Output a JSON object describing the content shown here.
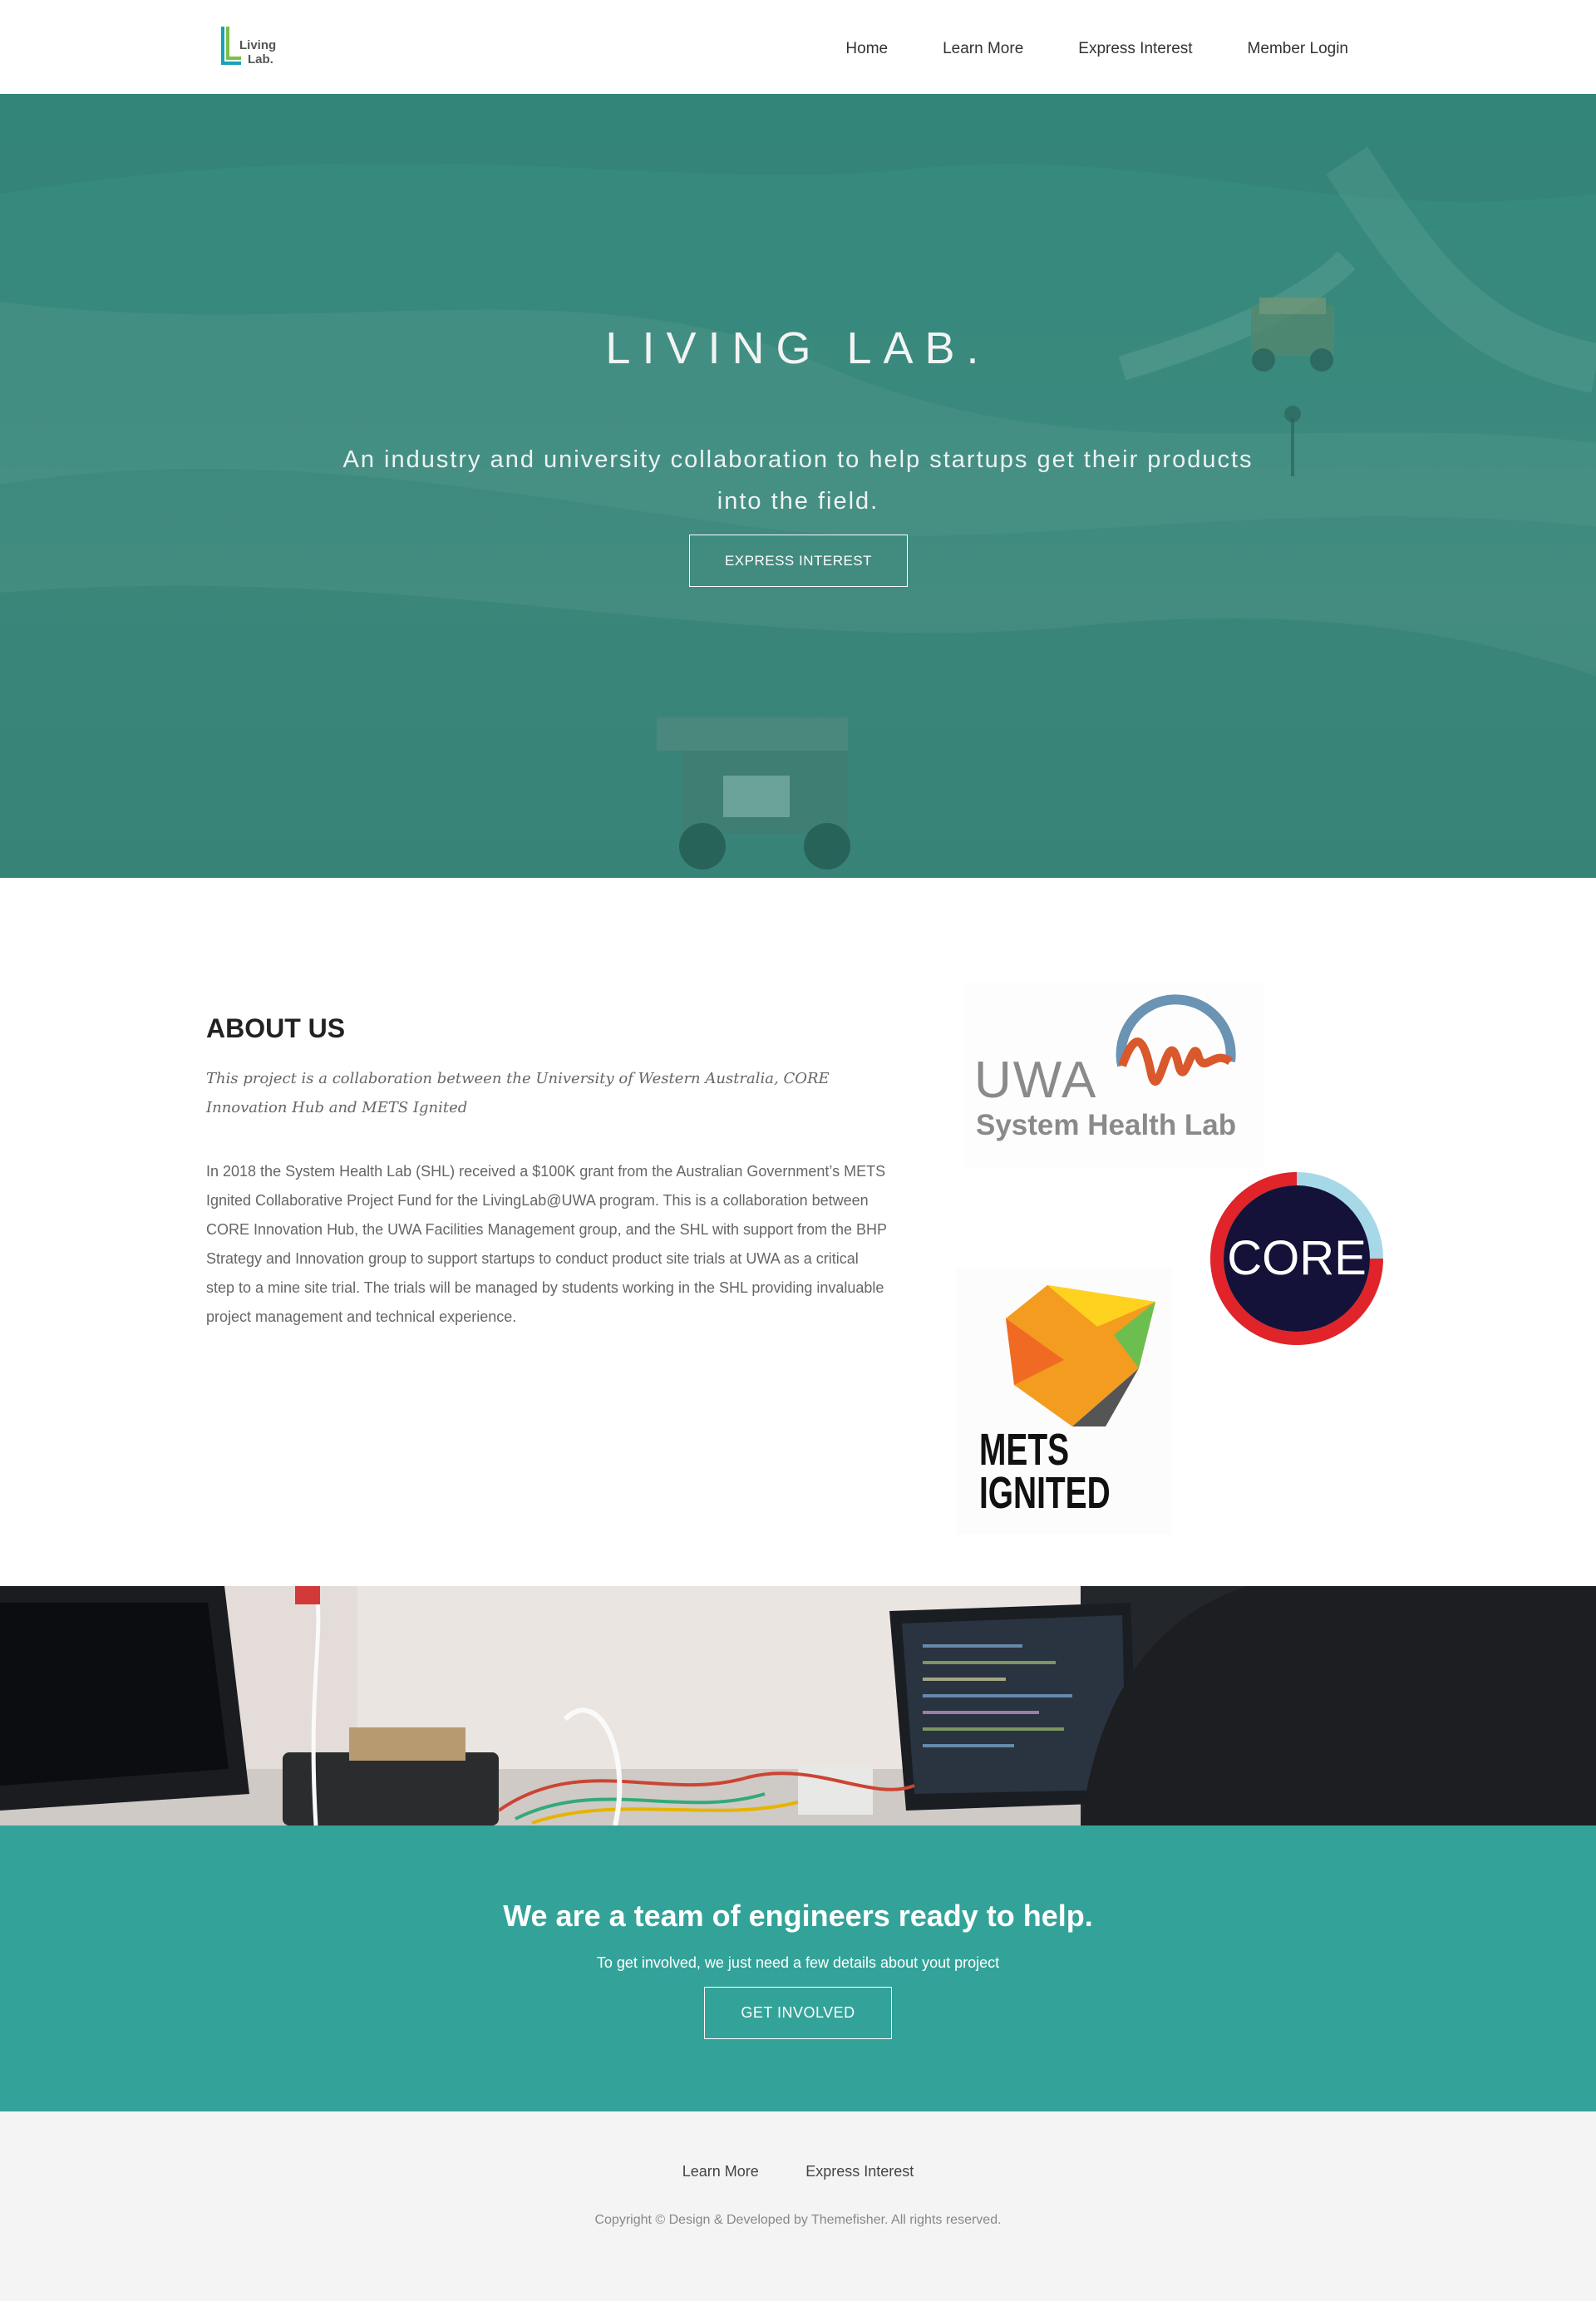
{
  "brand": {
    "logo_line1": "Living",
    "logo_line2": "Lab.",
    "colors": {
      "accent": "#33a39a",
      "logo_green": "#7bc043",
      "logo_teal": "#17a2b8"
    }
  },
  "nav": {
    "items": [
      "Home",
      "Learn More",
      "Express Interest",
      "Member Login"
    ]
  },
  "hero": {
    "title": "LIVING LAB.",
    "subtitle": "An industry and university collaboration to help startups get their products into the field.",
    "button_label": "EXPRESS INTEREST"
  },
  "about": {
    "title": "ABOUT US",
    "lead": "This project is a collaboration between the University of Western Australia, CORE Innovation Hub and METS Ignited",
    "body": "In 2018 the System Health Lab (SHL) received a $100K grant from the Australian Government’s METS Ignited Collaborative Project Fund for the LivingLab@UWA program. This is a collaboration between CORE Innovation Hub, the UWA Facilities Management group, and the SHL with support from the BHP Strategy and Innovation group to support startups to conduct product site trials at UWA as a critical step to a mine site trial. The trials will be managed by students working in the SHL providing invaluable project management and technical experience.",
    "logos": {
      "uwa_line1": "UWA",
      "uwa_line2": "System Health Lab",
      "core": "CORE",
      "mets_line1": "METS",
      "mets_line2": "IGNITED"
    }
  },
  "cta": {
    "title": "We are a team of engineers ready to help.",
    "subtitle": "To get involved, we just need a few details about yout project",
    "button_label": "GET INVOLVED"
  },
  "footer": {
    "links": [
      "Learn More",
      "Express Interest"
    ],
    "copyright": "Copyright © Design & Developed by Themefisher. All rights reserved."
  }
}
